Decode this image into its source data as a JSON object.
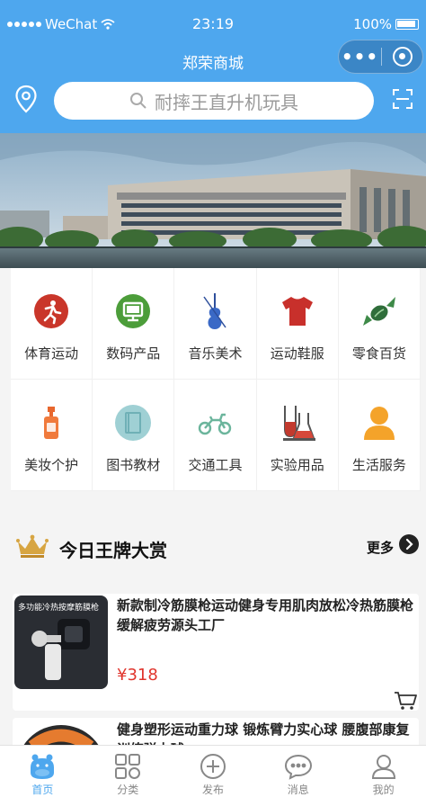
{
  "status_bar": {
    "carrier": "WeChat",
    "time": "23:19",
    "battery": "100%"
  },
  "header": {
    "title": "郑荣商城",
    "more_symbol": "•••"
  },
  "search": {
    "placeholder": "耐摔王直升机玩具"
  },
  "categories": [
    {
      "label": "体育运动",
      "icon": "running-icon"
    },
    {
      "label": "数码产品",
      "icon": "monitor-icon"
    },
    {
      "label": "音乐美术",
      "icon": "violin-icon"
    },
    {
      "label": "运动鞋服",
      "icon": "tshirt-icon"
    },
    {
      "label": "零食百货",
      "icon": "candy-icon"
    },
    {
      "label": "美妆个护",
      "icon": "lotion-bottle-icon"
    },
    {
      "label": "图书教材",
      "icon": "book-icon"
    },
    {
      "label": "交通工具",
      "icon": "motorcycle-icon"
    },
    {
      "label": "实验用品",
      "icon": "test-tube-icon"
    },
    {
      "label": "生活服务",
      "icon": "person-icon"
    }
  ],
  "section": {
    "title": "今日王牌大赏",
    "more_label": "更多"
  },
  "products": [
    {
      "name": "新款制冷筋膜枪运动健身专用肌肉放松冷热筋膜枪缓解疲劳源头工厂",
      "thumb_text": "多功能冷热按摩筋膜枪",
      "price": "¥318"
    },
    {
      "name": "健身塑形运动重力球 锻炼臂力实心球 腰腹部康复训练弹力球"
    }
  ],
  "tabs": [
    {
      "label": "首页",
      "icon": "home-hippo-icon",
      "active": true
    },
    {
      "label": "分类",
      "icon": "grid-icon",
      "active": false
    },
    {
      "label": "发布",
      "icon": "plus-circle-icon",
      "active": false
    },
    {
      "label": "消息",
      "icon": "chat-bubble-icon",
      "active": false
    },
    {
      "label": "我的",
      "icon": "user-icon",
      "active": false
    }
  ],
  "colors": {
    "brand_blue": "#4ea7ee",
    "price_red": "#e0342c"
  }
}
